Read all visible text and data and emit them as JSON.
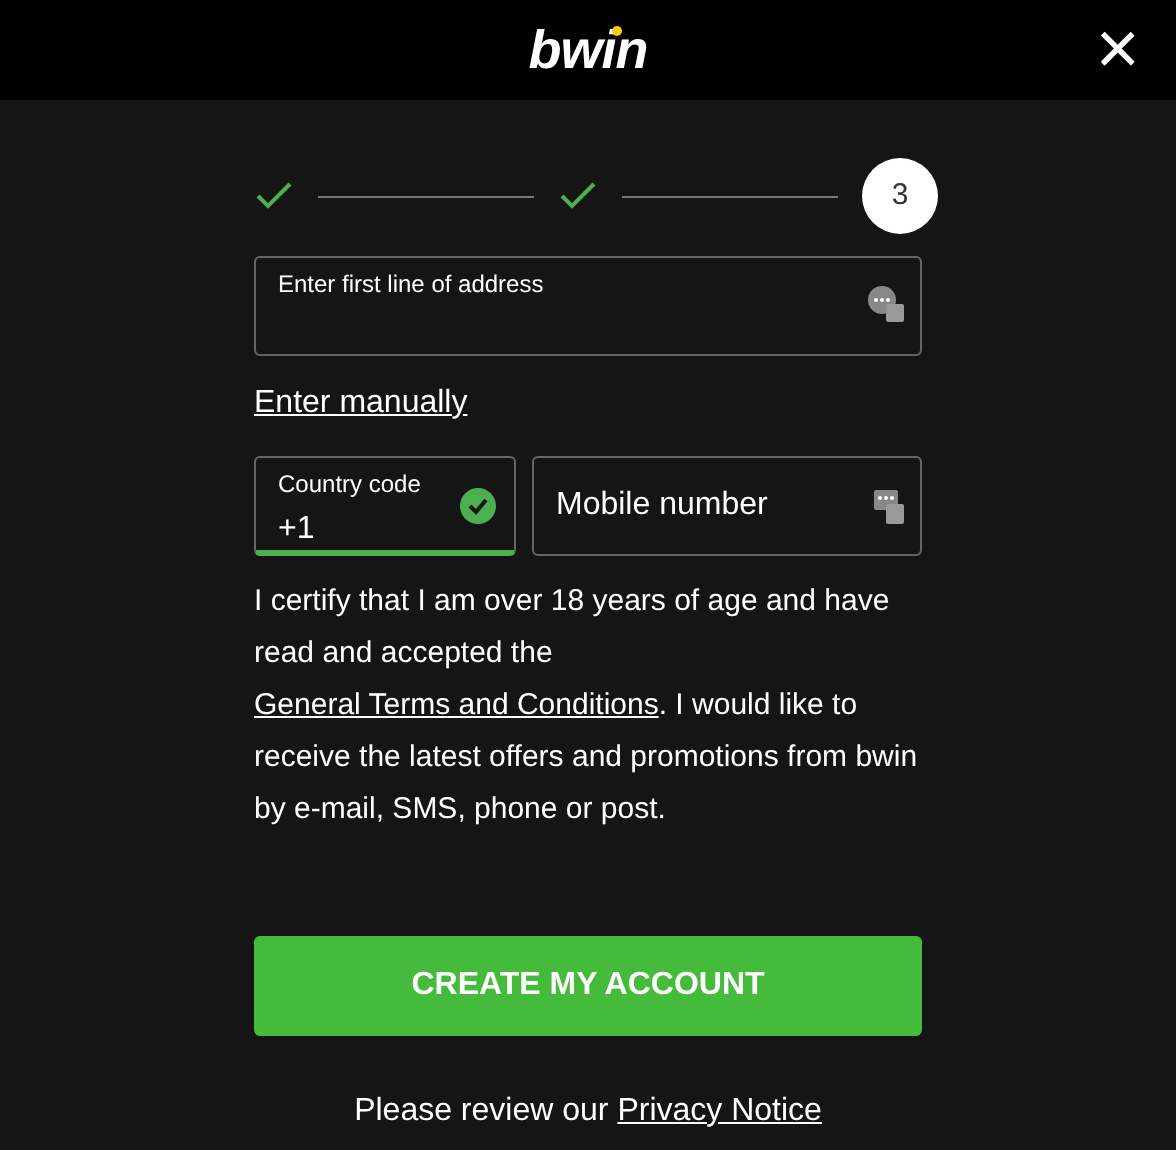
{
  "header": {
    "logo": "bwin",
    "close": "×"
  },
  "steps": [
    {
      "done": true
    },
    {
      "done": true
    },
    {
      "label": "3",
      "done": false
    }
  ],
  "address": {
    "placeholder": "Enter first line of address"
  },
  "enter_manually": "Enter manually",
  "country_code": {
    "label": "Country code",
    "value": "+1",
    "valid": true
  },
  "mobile": {
    "placeholder": "Mobile number"
  },
  "legal": {
    "before": "I certify that I am over 18 years of age and have read and accepted the ",
    "link": "General Terms and Conditions",
    "after": ". I would like to receive the latest offers and promotions from bwin by e-mail, SMS, phone or post."
  },
  "submit": "CREATE MY ACCOUNT",
  "privacy": {
    "before": "Please review our ",
    "link": "Privacy Notice"
  }
}
